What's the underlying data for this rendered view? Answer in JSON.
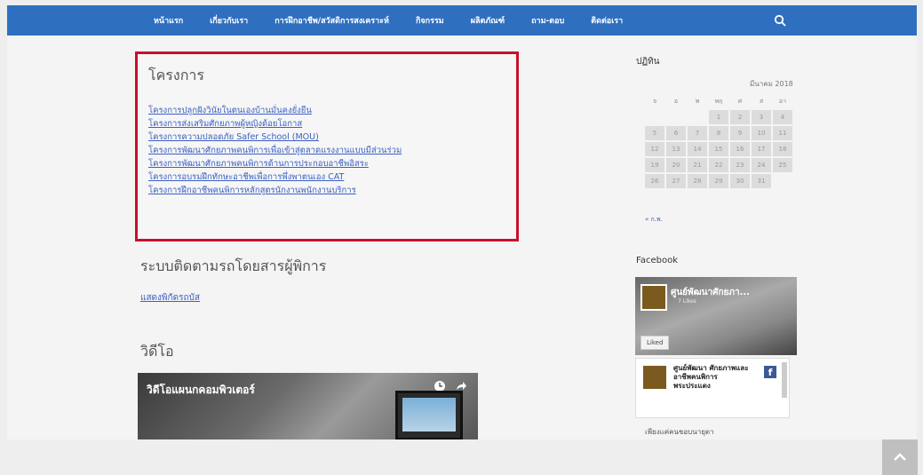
{
  "nav": {
    "items": [
      "หน้าแรก",
      "เกี่ยวกับเรา",
      "การฝึกอาชีพ/สวัสดิการสงเคราะห์",
      "กิจกรรม",
      "ผลิตภัณฑ์",
      "ถาม-ตอบ",
      "ติดต่อเรา"
    ],
    "search_icon": "search-icon"
  },
  "projects": {
    "title": "โครงการ",
    "links": [
      "โครงการปลูกฝังวินัยในตนเองบ้านมั่นคงยั่งยืน",
      "โครงการส่งเสริมศักยภาพผู้หญิงด้อยโอกาส",
      "โครงการความปลอดภัย Safer School (MOU)",
      "โครงการพัฒนาศักยภาพคนพิการเพื่อเข้าสู่ตลาดแรงงานแบบมีส่วนร่วม",
      "โครงการพัฒนาศักยภาพคนพิการด้านการประกอบอาชีพอิสระ",
      "โครงการอบรมฝึกทักษะอาชีพเพื่อการพึ่งพาตนเอง CAT",
      "โครงการฝึกอาชีพคนพิการหลักสูตรนักงานพนักงานบริการ"
    ]
  },
  "tracking": {
    "title": "ระบบติดตามรถโดยสารผู้พิการ",
    "link": "แสดงพิกัดรถบัส"
  },
  "video": {
    "title": "วิดีโอ",
    "caption": "วิดีโอแผนกคอมพิวเตอร์"
  },
  "calendar": {
    "title": "ปฏิทิน",
    "month": "มีนาคม 2018",
    "days": [
      "จ",
      "อ",
      "พ",
      "พฤ",
      "ศ",
      "ส",
      "อา"
    ],
    "weeks": [
      [
        "",
        "",
        "",
        "1",
        "2",
        "3",
        "4"
      ],
      [
        "5",
        "6",
        "7",
        "8",
        "9",
        "10",
        "11"
      ],
      [
        "12",
        "13",
        "14",
        "15",
        "16",
        "17",
        "18"
      ],
      [
        "19",
        "20",
        "21",
        "22",
        "23",
        "24",
        "25"
      ],
      [
        "26",
        "27",
        "28",
        "29",
        "30",
        "31",
        ""
      ]
    ],
    "prev": "« ก.พ."
  },
  "facebook": {
    "title": "Facebook",
    "page_name": "ศูนย์พัฒนาศักยภา...",
    "sub": "7 Likes",
    "liked": "Liked",
    "post_name": "ศูนย์พัฒนา ศักยภาพและอาชีพคนพิการ พระประแดง",
    "bottom_text": "เพียงแค่คนชอบนายุตา"
  }
}
